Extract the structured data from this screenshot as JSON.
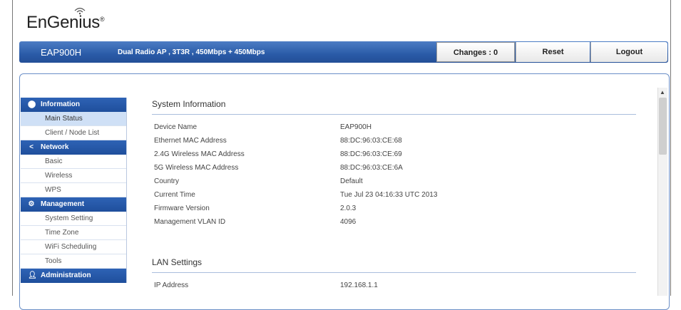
{
  "brand": {
    "logo_text": "EnGenius",
    "registered": "®"
  },
  "header": {
    "model": "EAP900H",
    "tagline": "Dual Radio AP , 3T3R , 450Mbps + 450Mbps",
    "changes_label": "Changes : 0",
    "reset_label": "Reset",
    "logout_label": "Logout"
  },
  "sidebar": {
    "sections": [
      {
        "label": "Information",
        "icon": "info-icon",
        "items": [
          "Main Status",
          "Client / Node List"
        ]
      },
      {
        "label": "Network",
        "icon": "share-icon",
        "items": [
          "Basic",
          "Wireless",
          "WPS"
        ]
      },
      {
        "label": "Management",
        "icon": "gear-icon",
        "items": [
          "System Setting",
          "Time Zone",
          "WiFi Scheduling",
          "Tools"
        ]
      },
      {
        "label": "Administration",
        "icon": "person-icon",
        "items": []
      }
    ],
    "active_item": "Main Status"
  },
  "main": {
    "system_info": {
      "title": "System Information",
      "rows": [
        {
          "label": "Device Name",
          "value": "EAP900H"
        },
        {
          "label": "Ethernet MAC Address",
          "value": "88:DC:96:03:CE:68"
        },
        {
          "label": "2.4G Wireless MAC Address",
          "value": "88:DC:96:03:CE:69"
        },
        {
          "label": "5G Wireless MAC Address",
          "value": "88:DC:96:03:CE:6A"
        },
        {
          "label": "Country",
          "value": "Default"
        },
        {
          "label": "Current Time",
          "value": "Tue Jul 23 04:16:33 UTC 2013"
        },
        {
          "label": "Firmware Version",
          "value": "2.0.3"
        },
        {
          "label": "Management VLAN ID",
          "value": "4096"
        }
      ]
    },
    "lan_settings": {
      "title": "LAN Settings",
      "rows": [
        {
          "label": "IP Address",
          "value": "192.168.1.1"
        }
      ]
    }
  },
  "colors": {
    "header_blue": "#2a5ba8",
    "active_item_bg": "#cfe0f6"
  }
}
